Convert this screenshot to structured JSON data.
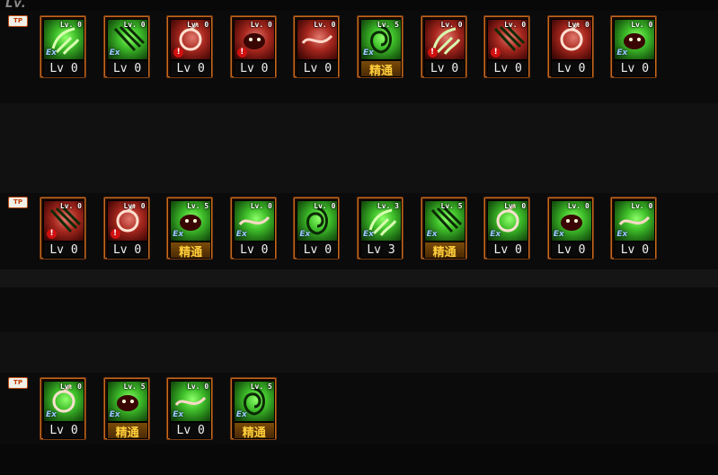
{
  "header": {
    "corner_label": "Lv."
  },
  "rows": [
    {
      "badge": "TP",
      "skills": [
        {
          "icon": "fist-energy-icon",
          "tint": "green",
          "mini": "Lv. 0",
          "marker": "ex",
          "level_label": "Lv 0",
          "mastered": false
        },
        {
          "icon": "claw-slash-icon",
          "tint": "green",
          "mini": "Lv. 0",
          "marker": "ex",
          "level_label": "Lv 0",
          "mastered": false
        },
        {
          "icon": "spin-kick-icon",
          "tint": "red",
          "mini": "Lv. 0",
          "marker": "warn",
          "level_label": "Lv 0",
          "mastered": false
        },
        {
          "icon": "beast-head-icon",
          "tint": "red",
          "mini": "Lv. 0",
          "marker": "warn",
          "level_label": "Lv 0",
          "mastered": false
        },
        {
          "icon": "whip-wave-icon",
          "tint": "red",
          "mini": "Lv. 0",
          "marker": "none",
          "level_label": "Lv 0",
          "mastered": false
        },
        {
          "icon": "vortex-icon",
          "tint": "green",
          "mini": "Lv. 5",
          "marker": "ex",
          "level_label": "精通",
          "mastered": true
        },
        {
          "icon": "grab-hand-icon",
          "tint": "red",
          "mini": "Lv. 0",
          "marker": "warn",
          "level_label": "Lv 0",
          "mastered": false
        },
        {
          "icon": "charge-icon",
          "tint": "red",
          "mini": "Lv. 0",
          "marker": "warn",
          "level_label": "Lv 0",
          "mastered": false
        },
        {
          "icon": "hook-icon",
          "tint": "red",
          "mini": "Lv. 0",
          "marker": "none",
          "level_label": "Lv 0",
          "mastered": false
        },
        {
          "icon": "power-fist-icon",
          "tint": "green",
          "mini": "Lv. 0",
          "marker": "ex",
          "level_label": "Lv 0",
          "mastered": false
        }
      ]
    },
    {
      "badge": "TP",
      "skills": [
        {
          "icon": "flame-burst-icon",
          "tint": "red",
          "mini": "Lv. 0",
          "marker": "warn",
          "level_label": "Lv 0",
          "mastered": false
        },
        {
          "icon": "sword-strike-icon",
          "tint": "red",
          "mini": "Lv. 0",
          "marker": "warn",
          "level_label": "Lv 0",
          "mastered": false
        },
        {
          "icon": "wind-slash-icon",
          "tint": "green",
          "mini": "Lv. 5",
          "marker": "ex",
          "level_label": "精通",
          "mastered": true
        },
        {
          "icon": "crescent-icon",
          "tint": "green",
          "mini": "Lv. 0",
          "marker": "ex",
          "level_label": "Lv 0",
          "mastered": false
        },
        {
          "icon": "wave-lines-icon",
          "tint": "green",
          "mini": "Lv. 0",
          "marker": "ex",
          "level_label": "Lv 0",
          "mastered": false
        },
        {
          "icon": "cloak-figure-icon",
          "tint": "green",
          "mini": "Lv. 3",
          "marker": "ex",
          "level_label": "Lv 3",
          "mastered": false
        },
        {
          "icon": "spiral-face-icon",
          "tint": "green",
          "mini": "Lv. 5",
          "marker": "ex",
          "level_label": "精通",
          "mastered": true
        },
        {
          "icon": "demon-face-icon",
          "tint": "green",
          "mini": "Lv. 0",
          "marker": "ex",
          "level_label": "Lv 0",
          "mastered": false
        },
        {
          "icon": "spike-burst-icon",
          "tint": "green",
          "mini": "Lv. 0",
          "marker": "ex",
          "level_label": "Lv 0",
          "mastered": false
        },
        {
          "icon": "dash-figure-icon",
          "tint": "green",
          "mini": "Lv. 0",
          "marker": "ex",
          "level_label": "Lv 0",
          "mastered": false
        }
      ]
    },
    {
      "badge": "TP",
      "skills": [
        {
          "icon": "tiger-head-icon",
          "tint": "green",
          "mini": "Lv. 0",
          "marker": "ex",
          "level_label": "Lv 0",
          "mastered": false
        },
        {
          "icon": "claw-rake-icon",
          "tint": "green",
          "mini": "Lv. 5",
          "marker": "ex",
          "level_label": "精通",
          "mastered": true
        },
        {
          "icon": "blade-dash-icon",
          "tint": "green",
          "mini": "Lv. 0",
          "marker": "ex",
          "level_label": "Lv 0",
          "mastered": false
        },
        {
          "icon": "roar-face-icon",
          "tint": "green",
          "mini": "Lv. 5",
          "marker": "ex",
          "level_label": "精通",
          "mastered": true
        }
      ]
    }
  ]
}
